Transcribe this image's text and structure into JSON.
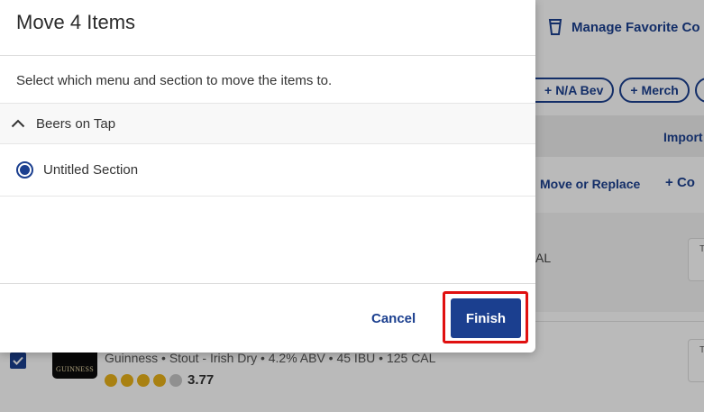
{
  "background": {
    "manage_favorites_label": "Manage Favorite Co",
    "chips": [
      {
        "label": "N/A Bev"
      },
      {
        "label": "Merch"
      },
      {
        "label": ""
      }
    ],
    "import_label": "Import",
    "move_or_replace_label": "Move or Replace",
    "add_label": "Co",
    "cal_fragment": "AL",
    "side_card_letter": "T",
    "beer": {
      "logo_text": "GUINNESS",
      "meta": "Guinness • Stout - Irish Dry • 4.2% ABV • 45 IBU • 125 CAL",
      "rating": "3.77",
      "rating_stars_filled": 4,
      "rating_stars_total": 5
    }
  },
  "modal": {
    "title": "Move 4 Items",
    "description": "Select which menu and section to move the items to.",
    "menu": {
      "label": "Beers on Tap",
      "expanded": true
    },
    "section": {
      "label": "Untitled Section",
      "selected": true
    },
    "cancel_label": "Cancel",
    "finish_label": "Finish"
  },
  "colors": {
    "accent": "#1b3f8f",
    "highlight": "#e01010",
    "rating_star": "#e8b11a"
  }
}
